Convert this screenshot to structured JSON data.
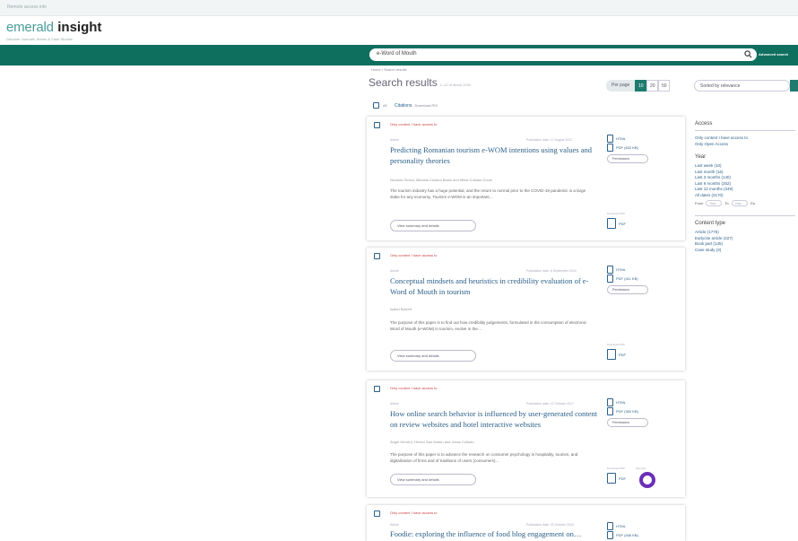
{
  "top": {
    "notice": "Remote access info"
  },
  "logo": {
    "word1": "emerald",
    "word2": "insight",
    "tagline": "Discover Journals, Books & Case Studies"
  },
  "search": {
    "value": "e-Word of Mouth",
    "advanced_label": "Advanced search"
  },
  "breadcrumb": "Home / Search results",
  "results": {
    "title": "Search results",
    "count": "1–10 of about 2000"
  },
  "per_page": {
    "label": "Per page",
    "options": [
      "10",
      "20",
      "50"
    ],
    "selected": "10"
  },
  "sort": {
    "value": "Sorted by relevance"
  },
  "selection": {
    "select_all_label": "All",
    "citations_label": "Citations",
    "download_label": "Download RIS"
  },
  "cards": [
    {
      "access": "Only content I have access to",
      "type": "Article",
      "date": "Publication date: 17 August 2022",
      "title": "Predicting Romanian tourism e-WOM intentions using values and personality theories",
      "authors": "Nicoleta Stoica, Mihaela Cristina Balan and Mihai Cristian Orzan",
      "abstract": "The tourism industry has a huge potential, and the return to normal prior to the COVID-19 pandemic is a large stake for any economy. Tourism e-WOM is an important…",
      "view_label": "View summary and details",
      "links": [
        "HTML",
        "PDF (632 KB)"
      ],
      "permissions_label": "Permissions",
      "pdf_caption": "Download PDF",
      "pdf_label": "PDF"
    },
    {
      "access": "Only content I have access to",
      "type": "Article",
      "date": "Publication date: 8 September 2015",
      "title": "Conceptual mindsets and heuristics in credibility evaluation of e-Word of Mouth in tourism",
      "authors": "Isabel Barrett",
      "abstract": "The purpose of this paper is to find out how credibility judgements, formulated in the consumption of electronic Word of Mouth (e-WOM) in tourism, evolve in the…",
      "view_label": "View summary and details",
      "links": [
        "HTML",
        "PDF (411 KB)"
      ],
      "permissions_label": "Permissions",
      "pdf_caption": "Download PDF",
      "pdf_label": "PDF"
    },
    {
      "access": "Only content I have access to",
      "type": "Article",
      "date": "Publication date: 12 October 2017",
      "title": "How online search behavior is influenced by user-generated content on review websites and hotel interactive websites",
      "authors": "Ángel Herrero, Héctor San Martín and Jesús Collado",
      "abstract": "The purpose of this paper is to advance the research on consumer psychology in hospitality, tourism, and digitalization of firms and of traditions of users (consumers)…",
      "view_label": "View summary and details",
      "links": [
        "HTML",
        "PDF (360 KB)"
      ],
      "permissions_label": "Permissions",
      "pdf_caption": "Download PDF",
      "pdf_label": "PDF",
      "altmetric_caption": "Altmetric"
    },
    {
      "access": "Only content I have access to",
      "type": "Article",
      "date": "Publication date: 23 October 2020",
      "title": "Foodie: exploring the influence of food blog engagement on…",
      "links": [
        "HTML",
        "PDF (546 KB)"
      ]
    }
  ],
  "filters": {
    "access_heading": "Access",
    "access_items": [
      "Only content I have access to",
      "Only Open Access"
    ],
    "year_heading": "Year",
    "year_items": [
      "Last week (10)",
      "Last month (16)",
      "Last 3 months (140)",
      "Last 6 months (252)",
      "Last 12 months (349)",
      "All dates (2170)"
    ],
    "from_label": "From",
    "from_placeholder": "Year",
    "to_label": "To",
    "to_placeholder": "Year",
    "go_label": "Go",
    "type_heading": "Content type",
    "type_items": [
      "Article (1775)",
      "Earlycite article (227)",
      "Book part (145)",
      "Case study (3)"
    ]
  }
}
